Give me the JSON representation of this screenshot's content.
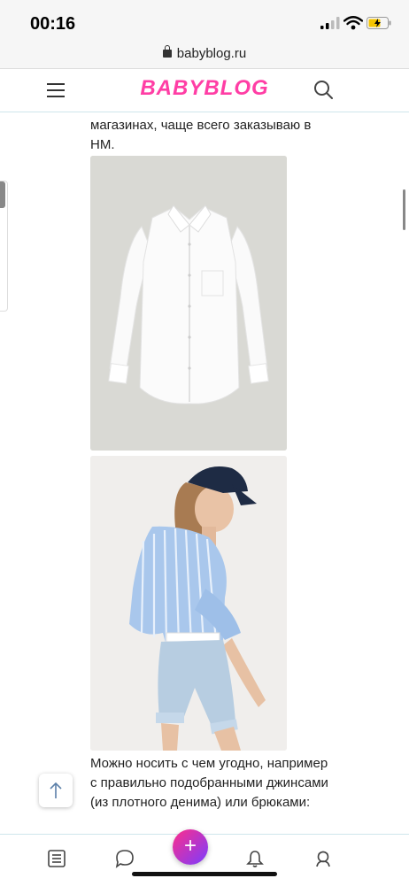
{
  "status_bar": {
    "time": "00:16"
  },
  "browser": {
    "url": "babyblog.ru"
  },
  "header": {
    "logo": "BABYBLOG"
  },
  "article": {
    "paragraph_top": "магазинах, чаще всего заказываю в НМ.",
    "paragraph_bottom": "Можно носить с чем угодно, например с правильно подобранными джинсами (из плотного денима) или брюками:"
  },
  "bottom_nav": {
    "add_label": "+"
  },
  "icons": [
    "lock-icon",
    "menu-icon",
    "search-icon",
    "arrow-up-icon",
    "feed-icon",
    "chat-icon",
    "bell-icon",
    "profile-icon",
    "plus-icon"
  ],
  "colors": {
    "brand": "#ff3ea5",
    "fab_start": "#ff2e8a",
    "fab_end": "#7a3cff"
  }
}
